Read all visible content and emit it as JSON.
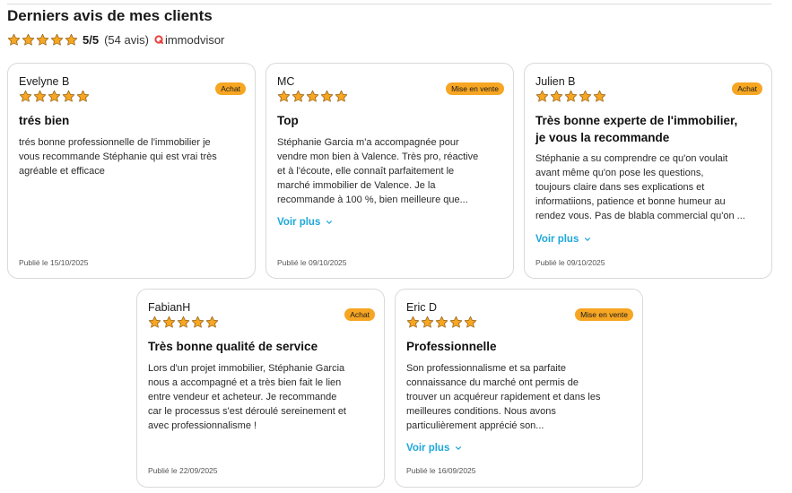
{
  "section": {
    "title": "Derniers avis de mes clients"
  },
  "summary": {
    "score": "5/5",
    "count": "(54 avis)",
    "brand": "immodvisor"
  },
  "colors": {
    "star": "#f6a623",
    "badge": "#f6a623",
    "link": "#1ea7d8",
    "brand": "#e8423f"
  },
  "reviews": [
    {
      "author": "Evelyne B",
      "badge": "Achat",
      "title": "trés bien",
      "lines": [
        "trés bonne professionnelle de l'immobilier je",
        "vous recommande Stéphanie qui est vrai très",
        "agréable et efficace"
      ],
      "more": "",
      "date": "Publié le 15/10/2025"
    },
    {
      "author": "MC",
      "badge": "Mise en vente",
      "title": "Top",
      "lines": [
        "Stéphanie Garcia m'a accompagnée pour",
        "vendre mon bien à Valence. Très pro, réactive",
        "et à l'écoute, elle connaît parfaitement le",
        "marché immobilier de Valence. Je la",
        "recommande à 100 %, bien meilleure que..."
      ],
      "more": "Voir plus",
      "date": "Publié le 09/10/2025"
    },
    {
      "author": "Julien B",
      "badge": "Achat",
      "title_lines": [
        "Très bonne experte de l'immobilier,",
        "je vous la recommande"
      ],
      "lines": [
        "Stéphanie a su comprendre ce qu'on voulait",
        "avant même qu'on pose les questions,",
        "toujours claire dans ses explications et",
        "informatiions, patience et bonne humeur au",
        "rendez vous. Pas de blabla commercial qu'on ..."
      ],
      "more": "Voir plus",
      "date": "Publié le 09/10/2025"
    },
    {
      "author": "FabianH",
      "badge": "Achat",
      "title": "Très bonne qualité de service",
      "lines": [
        "Lors d'un projet immobilier, Stéphanie Garcia",
        "nous a accompagné et a très bien fait le lien",
        "entre vendeur et acheteur. Je recommande",
        "car le processus s'est déroulé sereinement et",
        "avec professionnalisme !"
      ],
      "more": "",
      "date": "Publié le 22/09/2025"
    },
    {
      "author": "Eric D",
      "badge": "Mise en vente",
      "title": "Professionnelle",
      "lines": [
        "Son professionnalisme et sa parfaite",
        "connaissance du marché ont permis de",
        "trouver un acquéreur rapidement et dans les",
        "meilleures conditions. Nous avons",
        "particulièrement apprécié son..."
      ],
      "more": "Voir plus",
      "date": "Publié le 16/09/2025"
    }
  ]
}
